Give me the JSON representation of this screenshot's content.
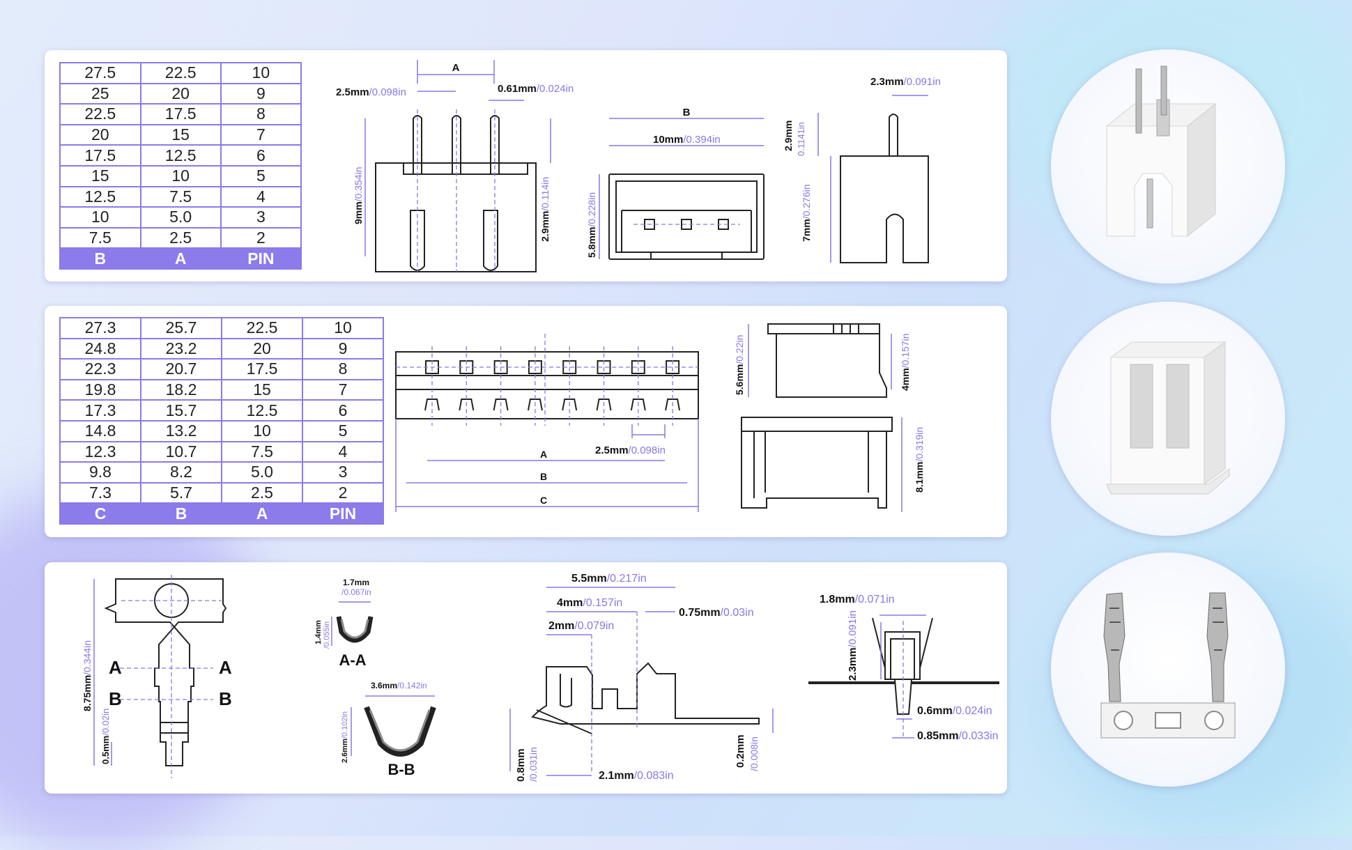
{
  "table1": {
    "headers": [
      "B",
      "A",
      "PIN"
    ],
    "rows": [
      [
        "27.5",
        "22.5",
        "10"
      ],
      [
        "25",
        "20",
        "9"
      ],
      [
        "22.5",
        "17.5",
        "8"
      ],
      [
        "20",
        "15",
        "7"
      ],
      [
        "17.5",
        "12.5",
        "6"
      ],
      [
        "15",
        "10",
        "5"
      ],
      [
        "12.5",
        "7.5",
        "4"
      ],
      [
        "10",
        "5.0",
        "3"
      ],
      [
        "7.5",
        "2.5",
        "2"
      ]
    ]
  },
  "table2": {
    "headers": [
      "C",
      "B",
      "A",
      "PIN"
    ],
    "rows": [
      [
        "27.3",
        "25.7",
        "22.5",
        "10"
      ],
      [
        "24.8",
        "23.2",
        "20",
        "9"
      ],
      [
        "22.3",
        "20.7",
        "17.5",
        "8"
      ],
      [
        "19.8",
        "18.2",
        "15",
        "7"
      ],
      [
        "17.3",
        "15.7",
        "12.5",
        "6"
      ],
      [
        "14.8",
        "13.2",
        "10",
        "5"
      ],
      [
        "12.3",
        "10.7",
        "7.5",
        "4"
      ],
      [
        "9.8",
        "8.2",
        "5.0",
        "3"
      ],
      [
        "7.3",
        "5.7",
        "2.5",
        "2"
      ]
    ]
  },
  "header_dims": {
    "label_a": "A",
    "pitch_mm": "2.5mm",
    "pitch_in": "/0.098in",
    "pin_w_mm": "0.61mm",
    "pin_w_in": "/0.024in",
    "height_mm": "9mm",
    "height_in": "/0.354in",
    "pin_top_mm": "2.9mm",
    "pin_top_in": "/0.114in",
    "label_b": "B",
    "width_mm": "10mm",
    "width_in": "/0.394in",
    "depth_mm": "5.8mm",
    "depth_in": "/0.228in",
    "side_pin_mm": "2.3mm",
    "side_pin_in": "/0.091in",
    "side_top_mm": "2.9mm",
    "side_top_in": "0.1141in",
    "side_body_mm": "7mm",
    "side_body_in": "/0.276in"
  },
  "housing_dims": {
    "pitch_mm": "2.5mm",
    "pitch_in": "/0.098in",
    "label_a": "A",
    "label_b": "B",
    "label_c": "C",
    "top_h_mm": "5.6mm",
    "top_h_in": "/0.22in",
    "step_mm": "4mm",
    "step_in": "/0.157in",
    "front_h_mm": "8.1mm",
    "front_h_in": "/0.319in"
  },
  "terminal_dims": {
    "length_mm": "8.75mm",
    "length_in": "/0.344in",
    "tip_mm": "0.5mm",
    "tip_in": "/0.02in",
    "sec_a": "A",
    "sec_b": "B",
    "aa_w_mm": "1.7mm",
    "aa_w_in": "/0.067in",
    "aa_h_mm": "1.4mm",
    "aa_h_in": "/0.055in",
    "aa_label": "A-A",
    "bb_w_mm": "3.6mm",
    "bb_w_in": "/0.142in",
    "bb_h_mm": "2.6mm",
    "bb_h_in": "/0.102in",
    "bb_label": "B-B",
    "total_mm": "5.5mm",
    "total_in": "/0.217in",
    "mid_mm": "4mm",
    "mid_in": "/0.157in",
    "front_mm": "2mm",
    "front_in": "/0.079in",
    "end_mm": "0.75mm",
    "end_in": "/0.03in",
    "base_mm": "0.8mm",
    "base_in": "/0.031in",
    "bottom_mm": "2.1mm",
    "bottom_in": "/0.083in",
    "thick_mm": "0.2mm",
    "thick_in": "/0.008in",
    "fw_mm": "1.8mm",
    "fw_in": "/0.071in",
    "fh_mm": "2.3mm",
    "fh_in": "/0.091in",
    "fb1_mm": "0.6mm",
    "fb1_in": "/0.024in",
    "fb2_mm": "0.85mm",
    "fb2_in": "/0.033in"
  },
  "colors": {
    "accent": "#8c7bea",
    "line": "#222222"
  },
  "icons": [
    "pin-header-render-icon",
    "housing-render-icon",
    "crimp-terminal-render-icon"
  ]
}
